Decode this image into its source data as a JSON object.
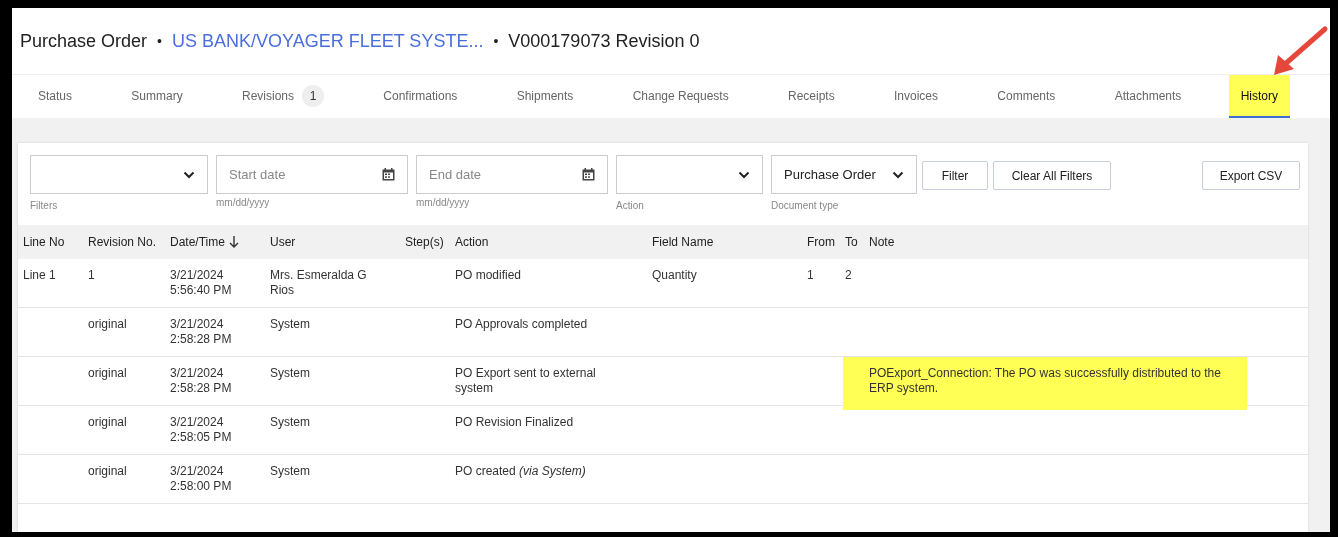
{
  "header": {
    "title": "Purchase Order",
    "separator_1": "•",
    "supplier_link": "US BANK/VOYAGER FLEET SYSTE...",
    "separator_2": "•",
    "document": "V000179073 Revision 0"
  },
  "tabs": [
    {
      "label": "Status",
      "selected": false,
      "highlighted": false
    },
    {
      "label": "Summary",
      "selected": false,
      "highlighted": false
    },
    {
      "label": "Revisions",
      "badge": "1",
      "selected": false,
      "highlighted": false
    },
    {
      "label": "Confirmations",
      "selected": false,
      "highlighted": false
    },
    {
      "label": "Shipments",
      "selected": false,
      "highlighted": false
    },
    {
      "label": "Change Requests",
      "selected": false,
      "highlighted": false
    },
    {
      "label": "Receipts",
      "selected": false,
      "highlighted": false
    },
    {
      "label": "Invoices",
      "selected": false,
      "highlighted": false
    },
    {
      "label": "Comments",
      "selected": false,
      "highlighted": false
    },
    {
      "label": "Attachments",
      "selected": false,
      "highlighted": false
    },
    {
      "label": "History",
      "selected": true,
      "highlighted": true
    }
  ],
  "filters": [
    {
      "kind": "select",
      "label": "Filters"
    },
    {
      "kind": "date",
      "placeholder": "Start date",
      "label": "mm/dd/yyyy"
    },
    {
      "kind": "date",
      "placeholder": "End date",
      "label": "mm/dd/yyyy"
    },
    {
      "kind": "select",
      "label": "Action"
    },
    {
      "kind": "select",
      "value": "Purchase Order",
      "label": "Document type"
    }
  ],
  "buttons": [
    "Filter",
    "Clear All Filters"
  ],
  "export_button": "Export CSV",
  "table": {
    "columns": [
      "Line No",
      "Revision No.",
      "Date/Time",
      "User",
      "Step(s)",
      "Action",
      "Field Name",
      "From",
      "To",
      "Note"
    ],
    "rows": [
      {
        "line_no": "Line 1",
        "revision": "1",
        "date": "3/21/2024",
        "time": "5:56:40 PM",
        "user": "Mrs. Esmeralda G Rios",
        "steps": "",
        "action": "PO modified",
        "field_name": "Quantity",
        "from": "1",
        "to": "2",
        "note": ""
      },
      {
        "line_no": "",
        "revision": "original",
        "date": "3/21/2024",
        "time": "2:58:28 PM",
        "user": "System",
        "steps": "",
        "action": "PO Approvals completed",
        "field_name": "",
        "from": "",
        "to": "",
        "note": ""
      },
      {
        "line_no": "",
        "revision": "original",
        "date": "3/21/2024",
        "time": "2:58:28 PM",
        "user": "System",
        "steps": "",
        "action": "PO Export sent to external system",
        "field_name": "",
        "from": "",
        "to": "",
        "note": "POExport_Connection: The PO was successfully distributed to the ERP system.",
        "note_highlighted": true
      },
      {
        "line_no": "",
        "revision": "original",
        "date": "3/21/2024",
        "time": "2:58:05 PM",
        "user": "System",
        "steps": "",
        "action": "PO Revision Finalized",
        "field_name": "",
        "from": "",
        "to": "",
        "note": ""
      },
      {
        "line_no": "",
        "revision": "original",
        "date": "3/21/2024",
        "time": "2:58:00 PM",
        "user": "System",
        "steps": "",
        "action": "PO created *(via System)*",
        "field_name": "",
        "from": "",
        "to": "",
        "note": ""
      }
    ]
  }
}
